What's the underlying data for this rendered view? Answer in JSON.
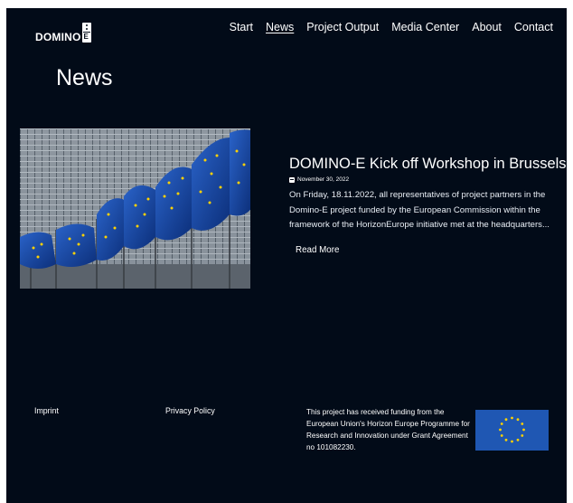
{
  "brand": {
    "name": "DOMINO",
    "mark_letter": "E"
  },
  "nav": {
    "items": [
      {
        "label": "Start",
        "active": false
      },
      {
        "label": "News",
        "active": true
      },
      {
        "label": "Project Output",
        "active": false
      },
      {
        "label": "Media Center",
        "active": false
      },
      {
        "label": "About",
        "active": false
      },
      {
        "label": "Contact",
        "active": false
      }
    ]
  },
  "page": {
    "title": "News"
  },
  "article": {
    "title": "DOMINO-E Kick off Workshop in Brussels",
    "date": "November 30, 2022",
    "excerpt": "On Friday, 18.11.2022, all representatives of project partners in the Domino-E project funded by the European Commission within the framework of the HorizonEurope initiative met at the headquarters...",
    "read_more": "Read More",
    "image_icon": "eu-flags-photo"
  },
  "footer": {
    "imprint": "Imprint",
    "privacy": "Privacy Policy",
    "funding_text": "This project has received funding from the European Union's Horizon Europe Programme for Research and Innovation under Grant Agreement no 101082230.",
    "flag_icon": "eu-flag-icon"
  },
  "colors": {
    "background": "#020b18",
    "text": "#ffffff",
    "eu_blue": "#1f57b3",
    "eu_gold": "#ffd200"
  }
}
